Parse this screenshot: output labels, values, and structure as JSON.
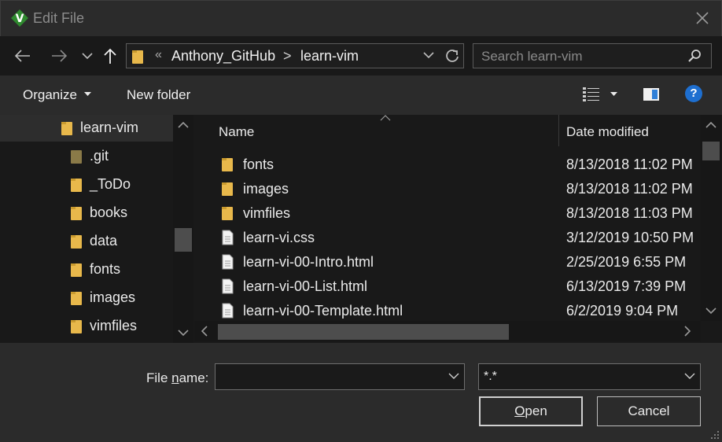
{
  "window": {
    "title": "Edit File",
    "close_icon": "close-icon"
  },
  "address": {
    "overflow_chevron": "«",
    "segments": [
      "Anthony_GitHub",
      "learn-vim"
    ],
    "separator": ">"
  },
  "search": {
    "placeholder": "Search learn-vim"
  },
  "toolbar": {
    "organize_label": "Organize",
    "new_folder_label": "New folder"
  },
  "nav_tree": {
    "parent": "learn-vim",
    "children": [
      ".git",
      "_ToDo",
      "books",
      "data",
      "fonts",
      "images",
      "vimfiles"
    ]
  },
  "file_list": {
    "columns": {
      "name": "Name",
      "date": "Date modified"
    },
    "rows": [
      {
        "name": "fonts",
        "date": "8/13/2018 11:02 PM",
        "type": "folder"
      },
      {
        "name": "images",
        "date": "8/13/2018 11:02 PM",
        "type": "folder"
      },
      {
        "name": "vimfiles",
        "date": "8/13/2018 11:03 PM",
        "type": "folder"
      },
      {
        "name": "learn-vi.css",
        "date": "3/12/2019 10:50 PM",
        "type": "file"
      },
      {
        "name": "learn-vi-00-Intro.html",
        "date": "2/25/2019 6:55 PM",
        "type": "file"
      },
      {
        "name": "learn-vi-00-List.html",
        "date": "6/13/2019 7:39 PM",
        "type": "file"
      },
      {
        "name": "learn-vi-00-Template.html",
        "date": "6/2/2019 9:04 PM",
        "type": "file"
      }
    ]
  },
  "footer": {
    "file_name_label_pre": "File ",
    "file_name_label_underlined": "n",
    "file_name_label_post": "ame:",
    "file_name_value": "",
    "file_type_value": "*.*",
    "open_label_underlined": "O",
    "open_label_rest": "pen",
    "cancel_label": "Cancel"
  },
  "colors": {
    "background": "#191919",
    "panel": "#2b2b2b",
    "folder": "#e8b84b",
    "help": "#1e6fd0"
  }
}
